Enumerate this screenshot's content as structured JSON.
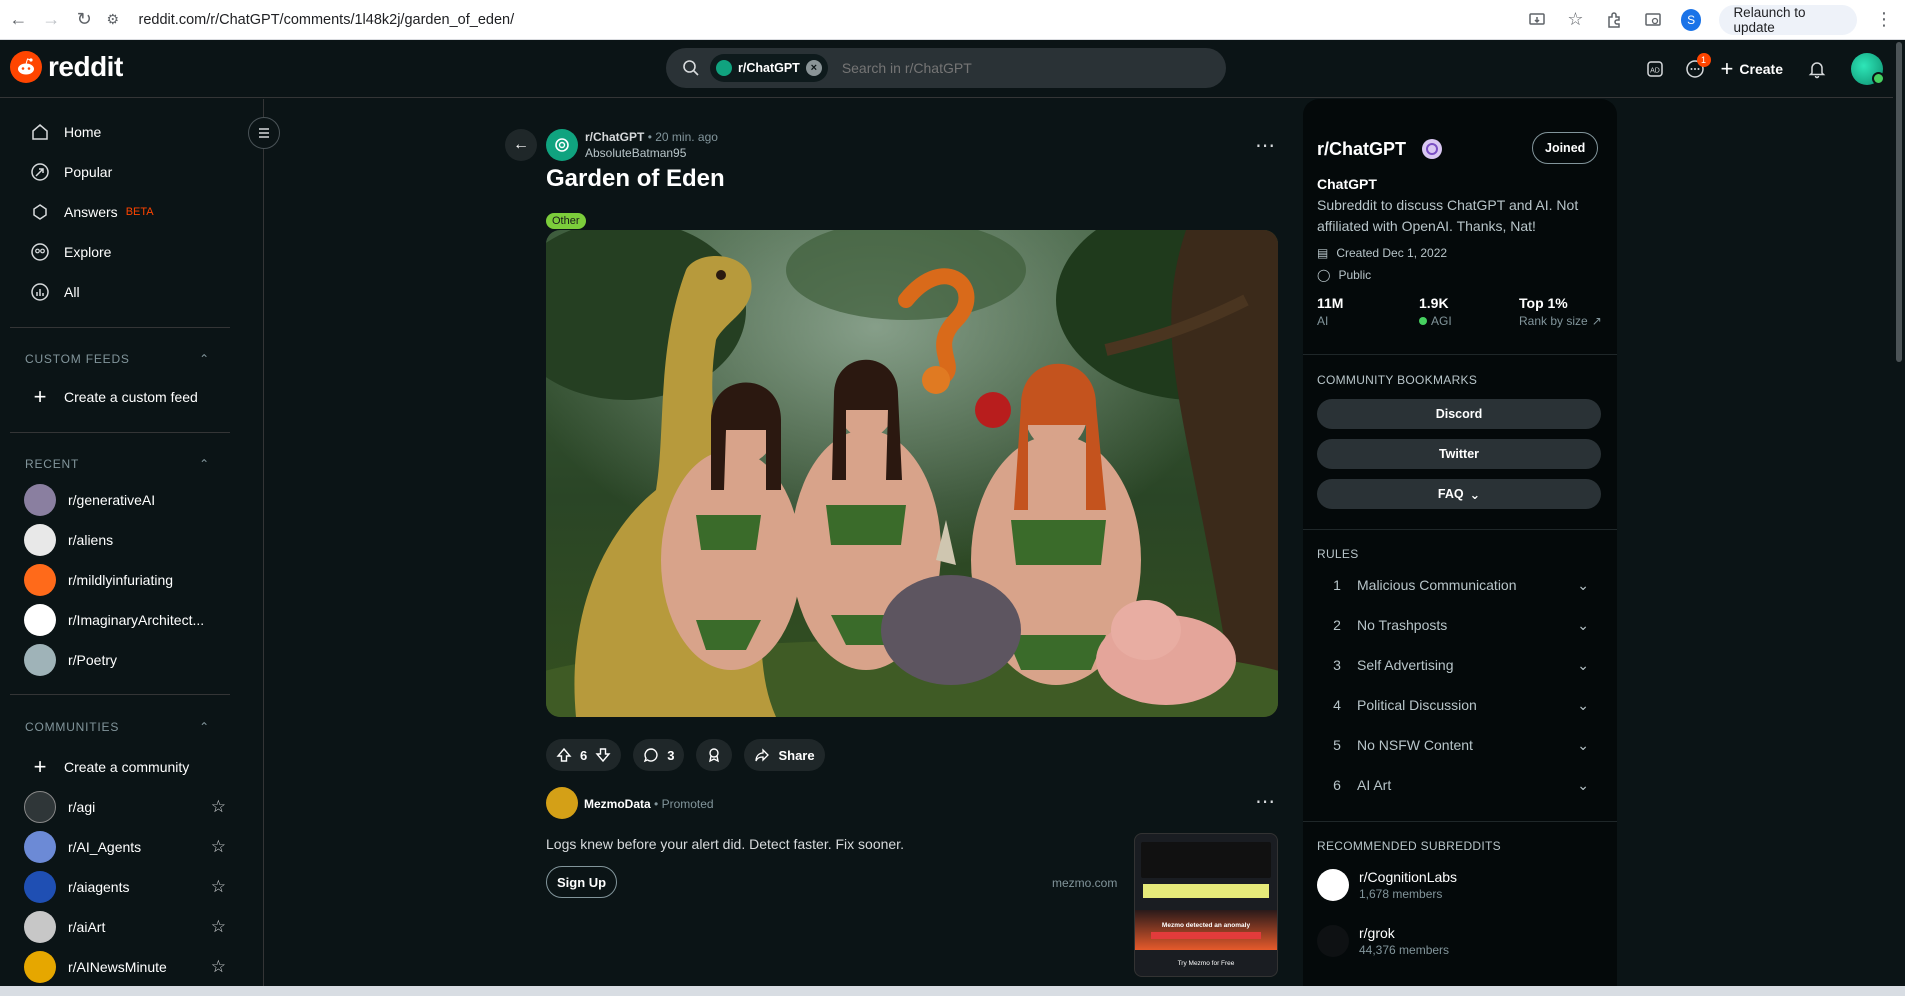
{
  "browser": {
    "url": "reddit.com/r/ChatGPT/comments/1l48k2j/garden_of_eden/",
    "profile_initial": "S",
    "relaunch_label": "Relaunch to update"
  },
  "header": {
    "logo_text": "reddit",
    "search_chip": "r/ChatGPT",
    "search_placeholder": "Search in r/ChatGPT",
    "chat_badge": "1",
    "create_label": "Create"
  },
  "sidebar": {
    "nav": [
      {
        "label": "Home",
        "icon": "home-icon"
      },
      {
        "label": "Popular",
        "icon": "popular-icon"
      },
      {
        "label": "Answers",
        "icon": "answers-icon",
        "tag": "BETA"
      },
      {
        "label": "Explore",
        "icon": "explore-icon"
      },
      {
        "label": "All",
        "icon": "all-icon"
      }
    ],
    "custom_feeds_title": "CUSTOM FEEDS",
    "create_feed_label": "Create a custom feed",
    "recent_title": "RECENT",
    "recent": [
      {
        "label": "r/generativeAI",
        "color": "#8a7fa0"
      },
      {
        "label": "r/aliens",
        "color": "#e8e8e8"
      },
      {
        "label": "r/mildlyinfuriating",
        "color": "#ff6a1a"
      },
      {
        "label": "r/ImaginaryArchitect...",
        "color": "#ffffff"
      },
      {
        "label": "r/Poetry",
        "color": "#9fb3b8"
      }
    ],
    "communities_title": "COMMUNITIES",
    "create_community_label": "Create a community",
    "communities": [
      {
        "label": "r/agi",
        "color": "#2f3638"
      },
      {
        "label": "r/AI_Agents",
        "color": "#6c8ad6"
      },
      {
        "label": "r/aiagents",
        "color": "#1f4fb3"
      },
      {
        "label": "r/aiArt",
        "color": "#c7c7c7"
      },
      {
        "label": "r/AINewsMinute",
        "color": "#e6a700"
      }
    ]
  },
  "post": {
    "subreddit": "r/ChatGPT",
    "time": "20 min. ago",
    "author": "AbsoluteBatman95",
    "title": "Garden of Eden",
    "flair": "Other",
    "votes": "6",
    "comments": "3",
    "share_label": "Share"
  },
  "promo": {
    "name": "MezmoData",
    "promoted": "Promoted",
    "text": "Logs knew before your alert did. Detect faster. Fix sooner.",
    "cta": "Sign Up",
    "domain": "mezmo.com",
    "thumb_title": "Mezmo detected an anomaly",
    "thumb_cta": "Try Mezmo for Free"
  },
  "community": {
    "title": "r/ChatGPT",
    "joined_label": "Joined",
    "name": "ChatGPT",
    "description": "Subreddit to discuss ChatGPT and AI. Not affiliated with OpenAI. Thanks, Nat!",
    "created": "Created Dec 1, 2022",
    "visibility": "Public",
    "stats": [
      {
        "value": "11M",
        "label": "AI"
      },
      {
        "value": "1.9K",
        "label": "AGI"
      },
      {
        "value": "Top 1%",
        "label": "Rank by size"
      }
    ],
    "bookmarks_title": "COMMUNITY BOOKMARKS",
    "bookmarks": [
      "Discord",
      "Twitter",
      "FAQ"
    ],
    "rules_title": "RULES",
    "rules": [
      {
        "n": "1",
        "label": "Malicious Communication"
      },
      {
        "n": "2",
        "label": "No Trashposts"
      },
      {
        "n": "3",
        "label": "Self Advertising"
      },
      {
        "n": "4",
        "label": "Political Discussion"
      },
      {
        "n": "5",
        "label": "No NSFW Content"
      },
      {
        "n": "6",
        "label": "AI Art"
      }
    ],
    "recommended_title": "RECOMMENDED SUBREDDITS",
    "recommended": [
      {
        "name": "r/CognitionLabs",
        "members": "1,678 members"
      },
      {
        "name": "r/grok",
        "members": "44,376 members"
      }
    ]
  },
  "colors": {
    "accent": "#ff4500",
    "online": "#46d160",
    "flair": "#7ccd3b"
  }
}
